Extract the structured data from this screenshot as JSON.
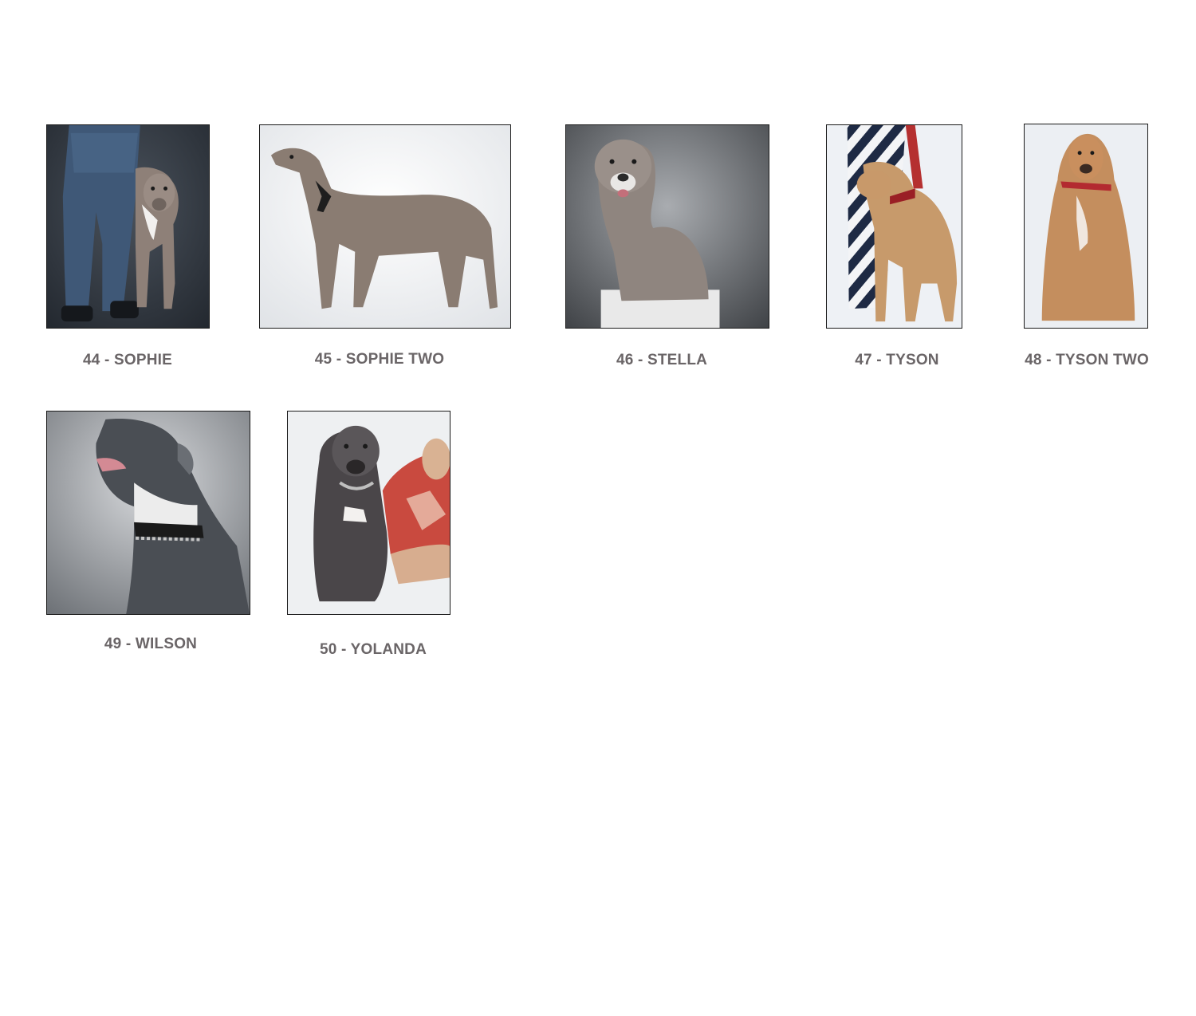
{
  "gallery": {
    "items": [
      {
        "caption": "44 - SOPHIE",
        "image": "dog-photo-sophie"
      },
      {
        "caption": "45 - SOPHIE TWO",
        "image": "dog-photo-sophie-two"
      },
      {
        "caption": "46 - STELLA",
        "image": "dog-photo-stella"
      },
      {
        "caption": "47 - TYSON",
        "image": "dog-photo-tyson"
      },
      {
        "caption": "48 - TYSON TWO",
        "image": "dog-photo-tyson-two"
      },
      {
        "caption": "49 - WILSON",
        "image": "dog-photo-wilson"
      },
      {
        "caption": "50 - YOLANDA",
        "image": "dog-photo-yolanda"
      }
    ]
  },
  "colors": {
    "caption_text": "#6a6567",
    "thumb_border": "#1a1a1a",
    "background": "#ffffff"
  }
}
